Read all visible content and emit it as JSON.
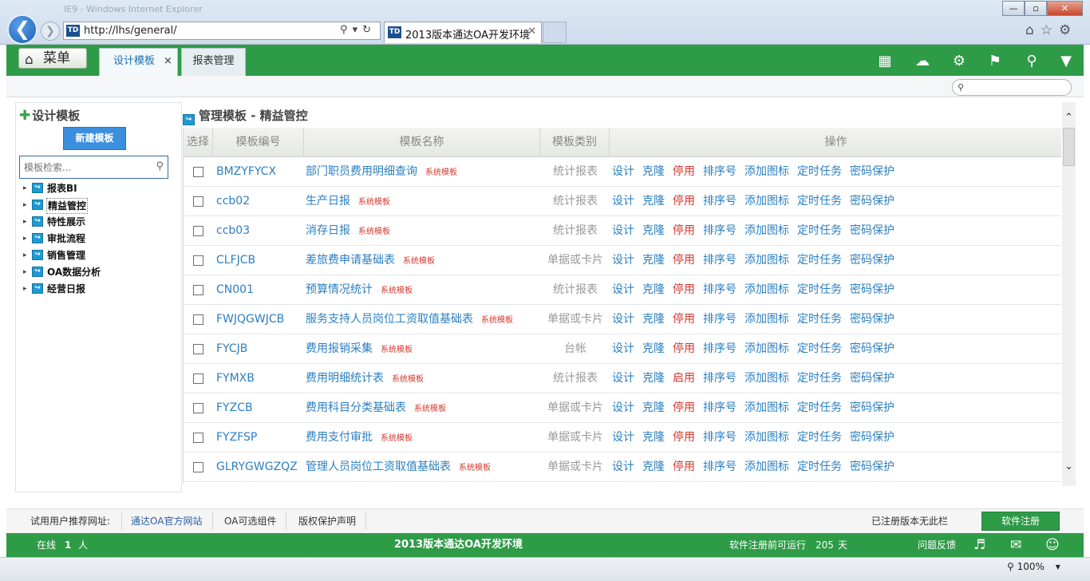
{
  "browser": {
    "url": "http://lhs/general/",
    "tab_title": "2013版本通达OA开发环境",
    "fav_label": "TD",
    "window_buttons": [
      "—",
      "▫",
      "✕"
    ],
    "faint_text": "IE9 - Windows Internet Explorer",
    "zoom": "100%",
    "brand_color": "#2e9b47"
  },
  "app": {
    "menu_label": "菜单",
    "tabs": [
      {
        "label": "设计模板",
        "close": "×"
      },
      {
        "label": "报表管理"
      }
    ],
    "header_icons": [
      "apps-icon",
      "cloud-help-icon",
      "settings-icon",
      "shirt-icon",
      "key-icon",
      "chevron-down-circle-icon"
    ],
    "search_placeholder": ""
  },
  "sidebar": {
    "title": "设计模板",
    "new_button": "新建模板",
    "search_placeholder": "模板检索...",
    "items": [
      {
        "label": "报表BI"
      },
      {
        "label": "精益管控"
      },
      {
        "label": "特性展示"
      },
      {
        "label": "审批流程"
      },
      {
        "label": "销售管理"
      },
      {
        "label": "OA数据分析"
      },
      {
        "label": "经营日报"
      }
    ]
  },
  "main": {
    "title": "管理模板 - 精益管控",
    "columns": [
      "选择",
      "模板编号",
      "模板名称",
      "模板类别",
      "操作"
    ],
    "rows": [
      {
        "code": "BMZYFYCX",
        "name": "部门职员费用明细查询",
        "tag": "系统模板",
        "category": "统计报表",
        "toggle": "停用"
      },
      {
        "code": "ccb02",
        "name": "生产日报",
        "tag": "系统模板",
        "category": "统计报表",
        "toggle": "停用"
      },
      {
        "code": "ccb03",
        "name": "消存日报",
        "tag": "系统模板",
        "category": "统计报表",
        "toggle": "停用"
      },
      {
        "code": "CLFJCB",
        "name": "差旅费申请基础表",
        "tag": "系统模板",
        "category": "单据或卡片",
        "toggle": "停用"
      },
      {
        "code": "CN001",
        "name": "预算情况统计",
        "tag": "系统模板",
        "category": "统计报表",
        "toggle": "停用"
      },
      {
        "code": "FWJQGWJCB",
        "name": "服务支持人员岗位工资取值基础表",
        "tag": "系统模板",
        "category": "单据或卡片",
        "toggle": "停用"
      },
      {
        "code": "FYCJB",
        "name": "费用报销采集",
        "tag": "系统模板",
        "category": "台帐",
        "toggle": "停用"
      },
      {
        "code": "FYMXB",
        "name": "费用明细统计表",
        "tag": "系统模板",
        "category": "统计报表",
        "toggle": "启用"
      },
      {
        "code": "FYZCB",
        "name": "费用科目分类基础表",
        "tag": "系统模板",
        "category": "单据或卡片",
        "toggle": "停用"
      },
      {
        "code": "FYZFSP",
        "name": "费用支付审批",
        "tag": "系统模板",
        "category": "单据或卡片",
        "toggle": "停用"
      },
      {
        "code": "GLRYGWGZQZ",
        "name": "管理人员岗位工资取值基础表",
        "tag": "系统模板",
        "category": "单据或卡片",
        "toggle": "停用"
      }
    ],
    "ops": {
      "design": "设计",
      "clone": "克隆",
      "sort": "排序号",
      "add_icon": "添加图标",
      "timer": "定时任务",
      "password": "密码保护"
    }
  },
  "footer": {
    "recommend_label": "试用用户推荐网址:",
    "links": [
      "通达OA官方网站",
      "OA可选组件",
      "版权保护声明"
    ],
    "registered_note": "已注册版本无此栏",
    "register_button": "软件注册",
    "online_label": "在线",
    "online_count": "1",
    "online_unit": "人",
    "center_title": "2013版本通达OA开发环境",
    "days_label": "软件注册前可运行",
    "days_value": "205",
    "days_unit": "天",
    "feedback": "问题反馈"
  }
}
